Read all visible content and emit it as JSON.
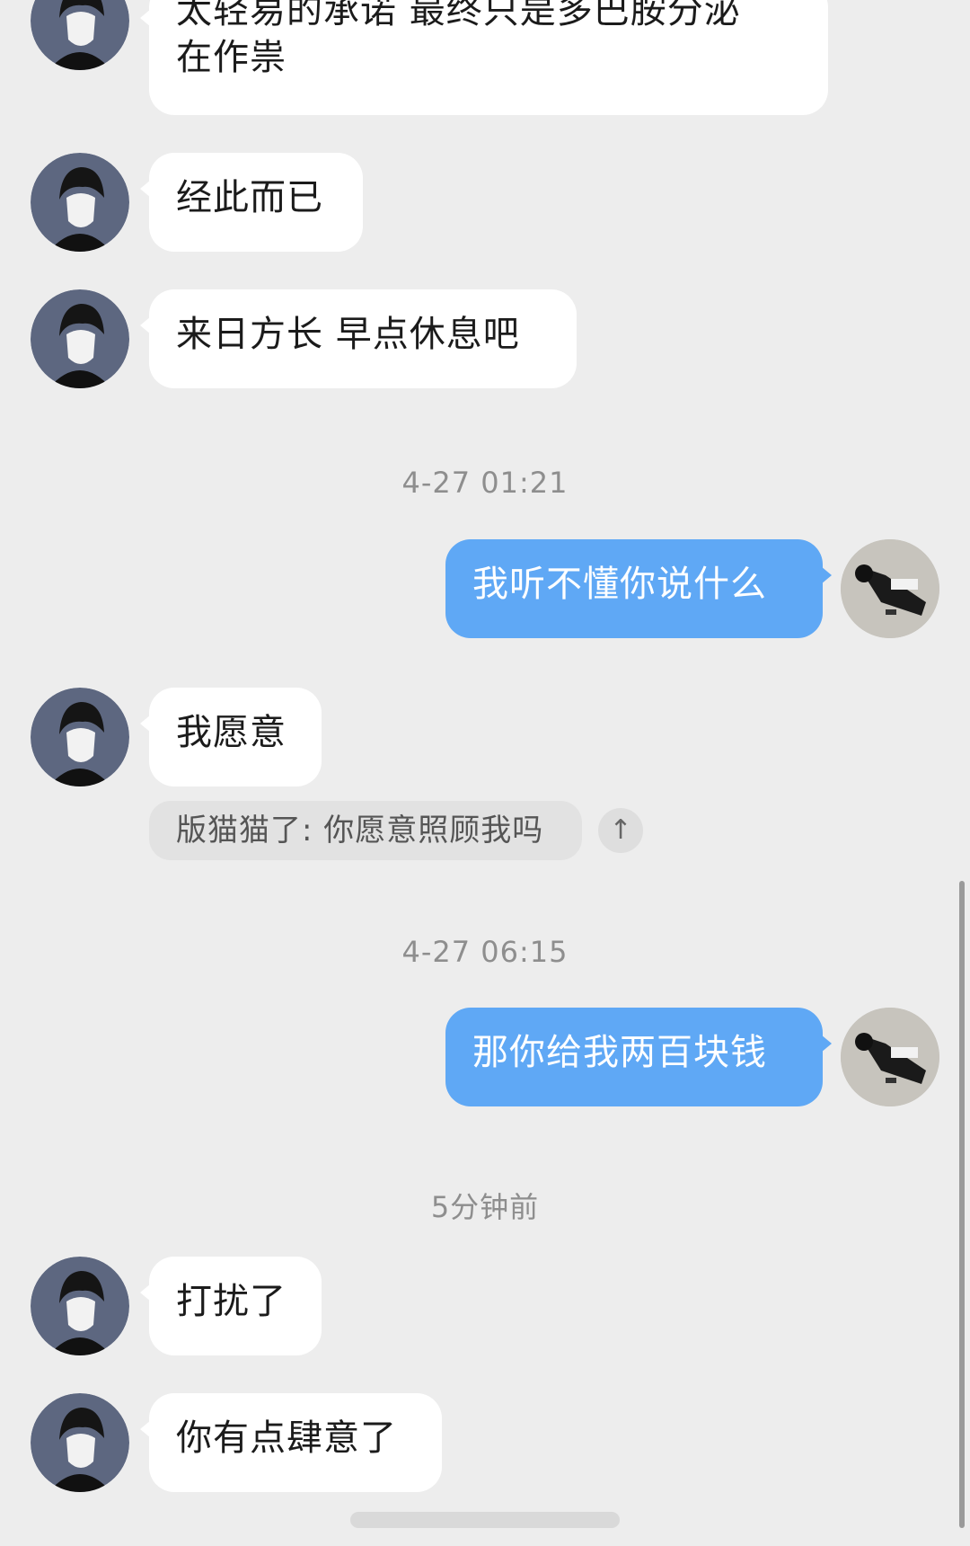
{
  "messages": [
    {
      "side": "in",
      "lines": [
        "太轻易的承诺 最终只是多巴胺分泌",
        "在作祟"
      ]
    },
    {
      "side": "in",
      "text": "经此而已"
    },
    {
      "side": "in",
      "text": "来日方长 早点休息吧"
    },
    {
      "side": "out",
      "text": "我听不懂你说什么"
    },
    {
      "side": "in",
      "text": "我愿意"
    },
    {
      "side": "out",
      "text": "那你给我两百块钱"
    },
    {
      "side": "in",
      "text": "打扰了"
    },
    {
      "side": "in",
      "text": "你有点肆意了"
    }
  ],
  "timestamps": [
    "4-27 01:21",
    "4-27 06:15",
    "5分钟前"
  ],
  "quote": {
    "text": "版猫猫了: 你愿意照顾我吗",
    "icon": "arrow-up-icon"
  },
  "colors": {
    "background": "#ededed",
    "incoming": "#ffffff",
    "outgoing": "#5fa8f5"
  }
}
